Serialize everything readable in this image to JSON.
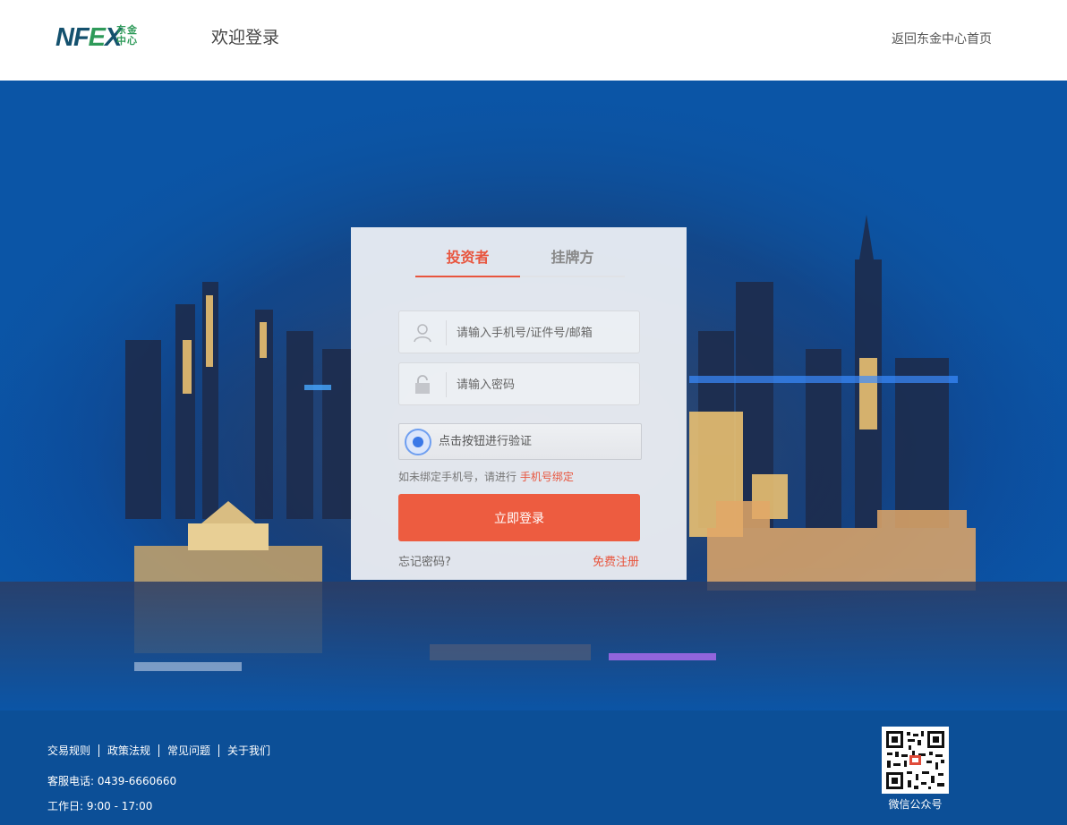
{
  "header": {
    "logo_text": "NFEX",
    "logo_cn": "东金中心",
    "page_title": "欢迎登录",
    "back_home": "返回东金中心首页"
  },
  "login": {
    "tabs": [
      {
        "label": "投资者",
        "active": true
      },
      {
        "label": "挂牌方",
        "active": false
      }
    ],
    "username_placeholder": "请输入手机号/证件号/邮箱",
    "password_placeholder": "请输入密码",
    "verify_text": "点击按钮进行验证",
    "bind_hint": "如未绑定手机号，请进行",
    "bind_link": "手机号绑定",
    "submit": "立即登录",
    "forgot": "忘记密码?",
    "register": "免费注册"
  },
  "footer": {
    "links": [
      "交易规则",
      "政策法规",
      "常见问题",
      "关于我们"
    ],
    "hotline": "客服电话: 0439-6660660",
    "workday": "工作日: 9:00 - 17:00",
    "qr_label": "微信公众号"
  },
  "colors": {
    "accent": "#ed5c40",
    "brand_blue": "#14516e",
    "brand_green": "#2e9a59",
    "footer_bg": "#0c4f97"
  }
}
